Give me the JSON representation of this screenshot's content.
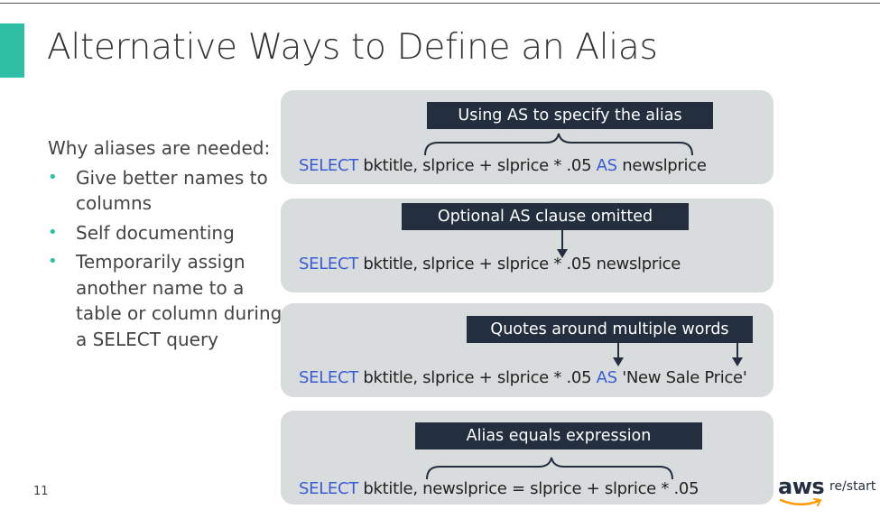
{
  "slide": {
    "title": "Alternative Ways to Define an Alias",
    "page_number": "11"
  },
  "sidebar": {
    "heading": "Why aliases are needed:",
    "bullets": [
      "Give better names to columns",
      "Self documenting",
      "Temporarily assign another name to a table or column during a SELECT query"
    ]
  },
  "panels": [
    {
      "label": "Using AS to specify the alias",
      "sql": {
        "kw1": "SELECT",
        "mid": " bktitle, slprice + slprice * .05 ",
        "kw2": "AS",
        "end": " newslprice"
      }
    },
    {
      "label": "Optional AS clause omitted",
      "sql": {
        "kw1": "SELECT",
        "mid": " bktitle, slprice + slprice * .05 newslprice"
      }
    },
    {
      "label": "Quotes around multiple words",
      "sql": {
        "kw1": "SELECT",
        "mid": " bktitle, slprice + slprice * .05 ",
        "kw2": "AS",
        "end": " 'New Sale Price'"
      }
    },
    {
      "label": "Alias equals expression",
      "sql": {
        "kw1": "SELECT",
        "mid": " bktitle, newslprice = slprice + slprice * .05"
      }
    }
  ],
  "logo": {
    "brand": "aws",
    "product": "re/start"
  },
  "colors": {
    "accent": "#2ebfa5",
    "keyword": "#3b5bd6",
    "label_bg": "#232f3e",
    "panel_bg": "#d9dcdd"
  }
}
